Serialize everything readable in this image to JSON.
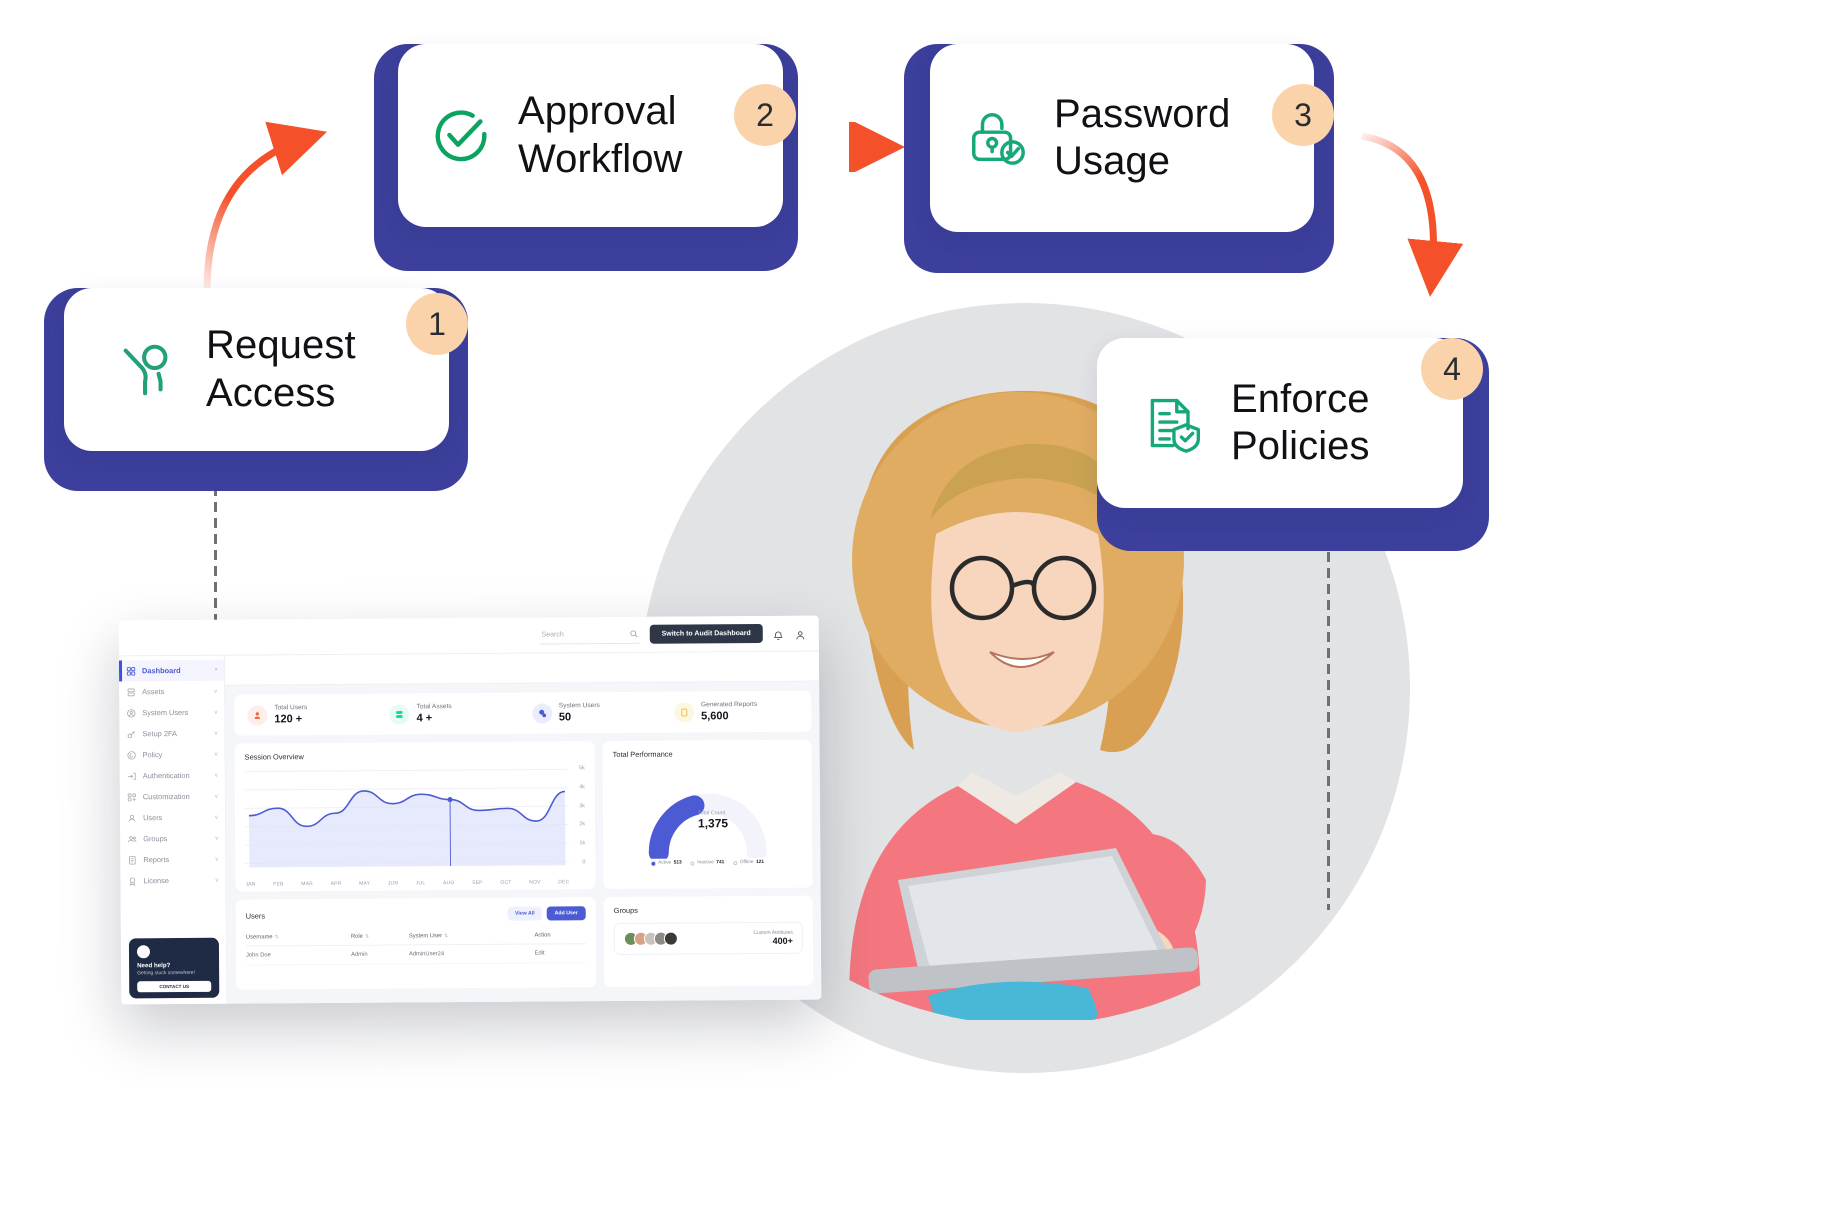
{
  "flow": {
    "steps": [
      {
        "number": "1",
        "label": "Request\nAccess",
        "icon": "request-access-icon",
        "icon_color": "#22a07a"
      },
      {
        "number": "2",
        "label": "Approval\nWorkflow",
        "icon": "check-circle-icon",
        "icon_color": "#0ba360"
      },
      {
        "number": "3",
        "label": "Password\nUsage",
        "icon": "lock-verified-icon",
        "icon_color": "#16a87a"
      },
      {
        "number": "4",
        "label": "Enforce\nPolicies",
        "icon": "document-shield-icon",
        "icon_color": "#16a87a"
      }
    ],
    "card_border_color": "#3c3f9b",
    "badge_color": "#fbd3ab",
    "arrow_color": "#f4502a"
  },
  "dashboard": {
    "topbar": {
      "search_placeholder": "Search",
      "search_value": "",
      "switch_button": "Switch to Audit Dashboard",
      "notification_count": "0"
    },
    "sidebar": {
      "items": [
        {
          "label": "Dashboard",
          "icon": "grid-icon",
          "badge": "*",
          "active": true,
          "chevron": ""
        },
        {
          "label": "Assets",
          "icon": "server-icon",
          "active": false,
          "chevron": "v"
        },
        {
          "label": "System Users",
          "icon": "user-circle-icon",
          "active": false,
          "chevron": "v"
        },
        {
          "label": "Setup 2FA",
          "icon": "key-icon",
          "active": false,
          "chevron": "v"
        },
        {
          "label": "Policy",
          "icon": "policy-icon",
          "active": false,
          "chevron": "v"
        },
        {
          "label": "Authentication",
          "icon": "login-icon",
          "active": false,
          "chevron": "v"
        },
        {
          "label": "Customization",
          "icon": "customize-icon",
          "active": false,
          "chevron": "v"
        },
        {
          "label": "Users",
          "icon": "user-icon",
          "active": false,
          "chevron": "v"
        },
        {
          "label": "Groups",
          "icon": "users-group-icon",
          "active": false,
          "chevron": "v"
        },
        {
          "label": "Reports",
          "icon": "report-icon",
          "active": false,
          "chevron": "v"
        },
        {
          "label": "License",
          "icon": "license-icon",
          "active": false,
          "chevron": "v"
        }
      ],
      "help_card": {
        "title": "Need help?",
        "subtitle": "Getting stuck somewhere!",
        "button": "CONTACT US"
      }
    },
    "stats": [
      {
        "label": "Total Users",
        "value": "120 +",
        "icon": "user-icon",
        "color": "#f4623f",
        "bg": "#fdeeea"
      },
      {
        "label": "Total Assets",
        "value": "4 +",
        "icon": "server-icon",
        "color": "#12d6a0",
        "bg": "#e6fbf4"
      },
      {
        "label": "System Users",
        "value": "50",
        "icon": "system-user-icon",
        "color": "#4c5bd4",
        "bg": "#ebedfc"
      },
      {
        "label": "Generated Reports",
        "value": "5,600",
        "icon": "report-icon",
        "color": "#f2c443",
        "bg": "#fdf6e0"
      }
    ],
    "session_panel": {
      "title": "Session Overview"
    },
    "performance_panel": {
      "title": "Total Performance",
      "center_caption": "Total Count",
      "center_value": "1,375",
      "legend": [
        {
          "label": "Active",
          "value": "513",
          "color": "#4c5bd4"
        },
        {
          "label": "Inactive",
          "value": "741",
          "color": "#ffffff"
        },
        {
          "label": "Offline",
          "value": "121",
          "color": "#ffffff"
        }
      ]
    },
    "users_panel": {
      "title": "Users",
      "view_all_label": "View All",
      "add_user_label": "Add User",
      "columns": [
        "Username",
        "Role",
        "System User",
        "Action"
      ],
      "rows": [
        {
          "username": "John Doe",
          "role": "Admin",
          "system_user": "AdminUser24",
          "action": "Edit"
        }
      ]
    },
    "groups_panel": {
      "title": "Groups",
      "attribute_label": "Custom Attributes",
      "attribute_value": "400+"
    }
  },
  "chart_data": {
    "type": "area",
    "title": "Session Overview",
    "categories": [
      "JAN",
      "FEB",
      "MAR",
      "APR",
      "MAY",
      "JUN",
      "JUL",
      "AUG",
      "SEP",
      "OCT",
      "NOV",
      "DEC"
    ],
    "values": [
      2600,
      3000,
      2000,
      2700,
      3900,
      3200,
      3700,
      3400,
      2800,
      2900,
      2200,
      3800
    ],
    "ylabel": "",
    "xlabel": "",
    "ytick_labels": [
      "5k",
      "4k",
      "3k",
      "2k",
      "1k",
      "0"
    ],
    "ylim": [
      0,
      5000
    ],
    "grid": true,
    "legend": "none",
    "marker_month": "AUG",
    "marker_value": 3400,
    "line_color": "#4c5bd4",
    "fill_color": "#dfe3fb"
  }
}
